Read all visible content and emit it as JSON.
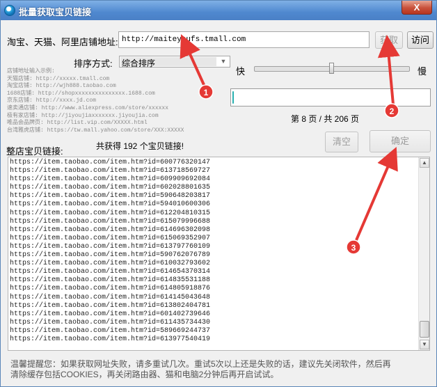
{
  "window": {
    "title": "批量获取宝贝链接",
    "close_label": "X"
  },
  "url_row": {
    "label": "淘宝、天猫、阿里店铺地址:",
    "value": "http://maiteyoufs.tmall.com",
    "fetch_button": "获取",
    "visit_button": "访问"
  },
  "sort": {
    "label": "排序方式:",
    "selected": "综合排序"
  },
  "speed": {
    "fast_label": "快",
    "slow_label": "慢",
    "level": 0.5
  },
  "examples": [
    "店铺地址输入示例:",
    "天猫店铺: http://xxxxx.tmall.com",
    "淘宝店铺: http://wjh888.taobao.com",
    "1688店铺: http://shopxxxxxxxxxxxxxxx.1688.com",
    "京东店铺: http://xxxx.jd.com",
    "速卖通店铺: http://www.aliexpress.com/store/xxxxxx",
    "极有家店铺: http://jiyoujiaxxxxxxx.jiyoujia.com",
    "唯品会品牌页: http://list.vip.com/XXXXX.html",
    "台湾雅虎店铺: https://tw.mall.yahoo.com/store/XXX:XXXXX"
  ],
  "progress": {
    "fraction": 0.006
  },
  "page_info": "第 8 页 / 共 206 页",
  "results": {
    "label": "整店宝贝链接:",
    "count_text": "共获得 192 个宝贝链接!",
    "clear_button": "清空",
    "confirm_button": "确定",
    "links": [
      "https://item.taobao.com/item.htm?id=600776320147",
      "https://item.taobao.com/item.htm?id=613718569727",
      "https://item.taobao.com/item.htm?id=609909692084",
      "https://item.taobao.com/item.htm?id=602028801635",
      "https://item.taobao.com/item.htm?id=590648203817",
      "https://item.taobao.com/item.htm?id=594010600306",
      "https://item.taobao.com/item.htm?id=612204810315",
      "https://item.taobao.com/item.htm?id=615079996688",
      "https://item.taobao.com/item.htm?id=614696302098",
      "https://item.taobao.com/item.htm?id=615069352907",
      "https://item.taobao.com/item.htm?id=613797760109",
      "https://item.taobao.com/item.htm?id=590762076789",
      "https://item.taobao.com/item.htm?id=610032793602",
      "https://item.taobao.com/item.htm?id=614654370314",
      "https://item.taobao.com/item.htm?id=614835531188",
      "https://item.taobao.com/item.htm?id=614805918876",
      "https://item.taobao.com/item.htm?id=614145043648",
      "https://item.taobao.com/item.htm?id=613802404781",
      "https://item.taobao.com/item.htm?id=601402739646",
      "https://item.taobao.com/item.htm?id=611435734430",
      "https://item.taobao.com/item.htm?id=589669244737",
      "https://item.taobao.com/item.htm?id=613977540419"
    ]
  },
  "tip": "温馨提醒您：如果获取网址失败，请多重试几次。重试5次以上还是失败的话，建议先关闭软件，然后再清除缓存包括COOKIES，再关闭路由器、猫和电脑2分钟后再开启试试。",
  "annotations": {
    "marker_1": "1",
    "marker_2": "2",
    "marker_3": "3",
    "color": "#e53935"
  }
}
